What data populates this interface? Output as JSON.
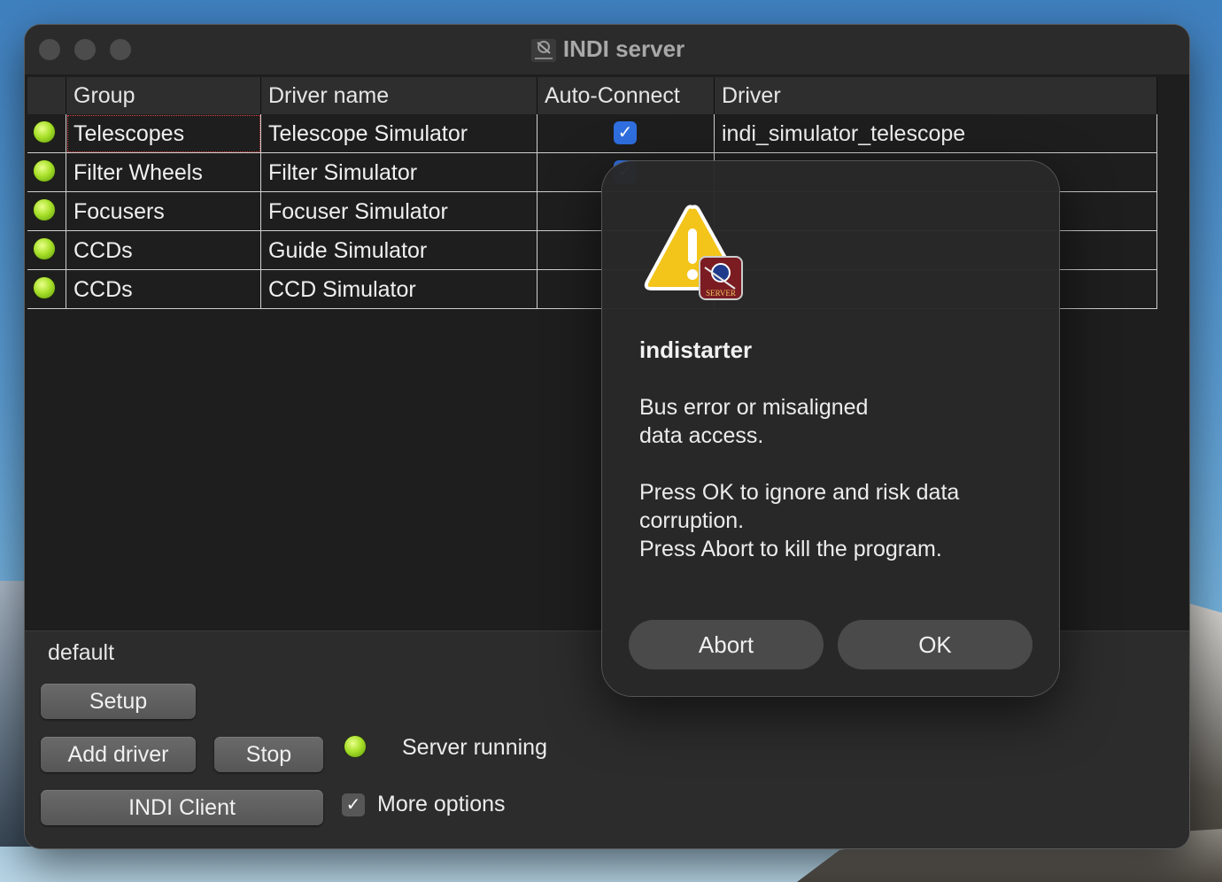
{
  "window": {
    "title": "INDI server"
  },
  "table": {
    "headers": [
      "Group",
      "Driver name",
      "Auto-Connect",
      "Driver"
    ],
    "rows": [
      {
        "group": "Telescopes",
        "driver_name": "Telescope Simulator",
        "auto_connect": true,
        "driver": "indi_simulator_telescope",
        "status": "running"
      },
      {
        "group": "Filter Wheels",
        "driver_name": "Filter Simulator",
        "auto_connect": true,
        "driver": "",
        "status": "running"
      },
      {
        "group": "Focusers",
        "driver_name": "Focuser Simulator",
        "auto_connect": false,
        "driver": "",
        "status": "running"
      },
      {
        "group": "CCDs",
        "driver_name": "Guide Simulator",
        "auto_connect": false,
        "driver": "",
        "status": "running"
      },
      {
        "group": "CCDs",
        "driver_name": "CCD Simulator",
        "auto_connect": false,
        "driver": "",
        "status": "running"
      }
    ]
  },
  "bottom": {
    "profile": "default",
    "setup_label": "Setup",
    "add_driver_label": "Add driver",
    "stop_label": "Stop",
    "server_status": "Server running",
    "indi_client_label": "INDI Client",
    "more_options_label": "More options",
    "more_options_checked": true
  },
  "dialog": {
    "title": "indistarter",
    "message_1": "Bus error or misaligned",
    "message_2": "data access.",
    "message_3": "Press OK to ignore and risk data",
    "message_4": "corruption.",
    "message_5": "Press Abort to kill the program.",
    "abort_label": "Abort",
    "ok_label": "OK",
    "icon_badge": "SERVER"
  },
  "colors": {
    "led_green": "#a9e12a",
    "checkbox_blue": "#2f6fe0",
    "warning_yellow": "#f3c419"
  }
}
